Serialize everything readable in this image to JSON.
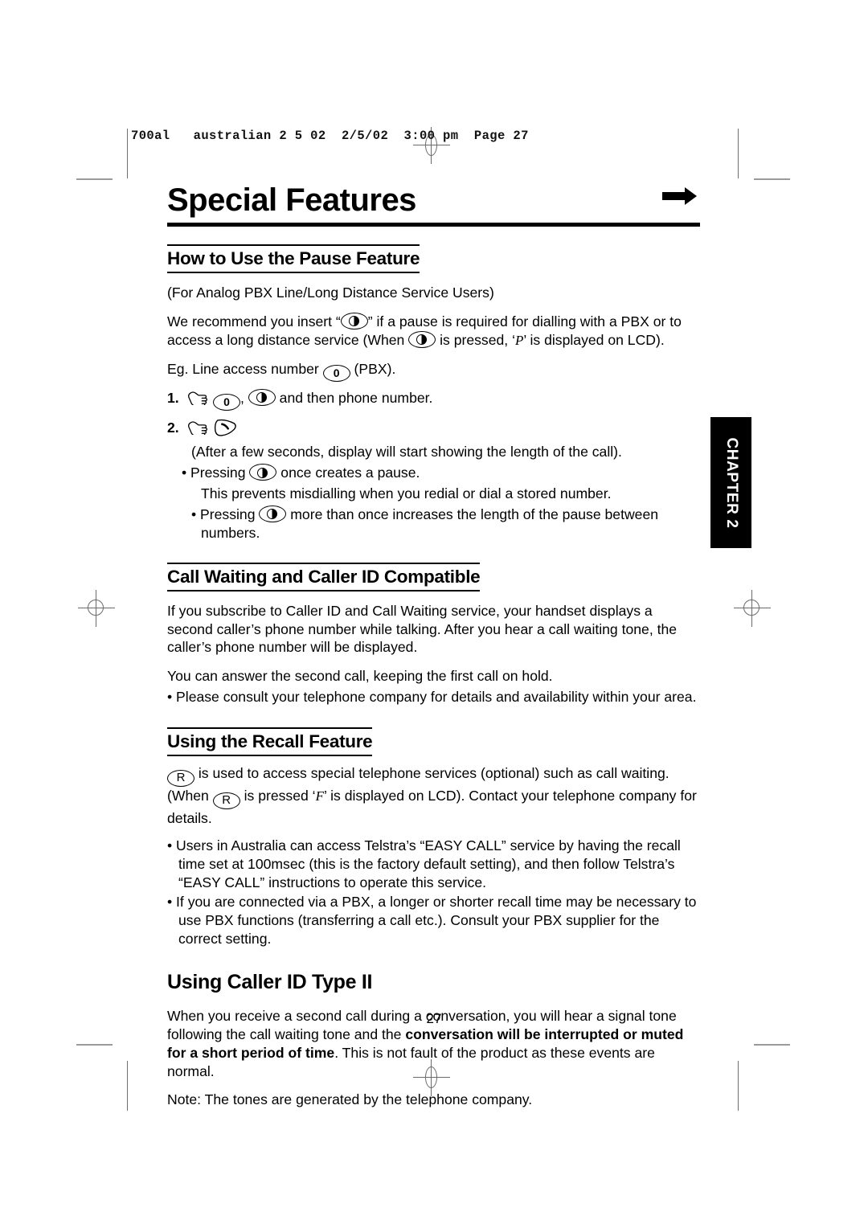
{
  "prepress": {
    "header_text": "700al   australian 2 5 02  2/5/02  3:00 pm  Page 27"
  },
  "chapter": {
    "title": "Special Features",
    "tab_label": "CHAPTER 2",
    "arrow_icon": "right-arrow-icon"
  },
  "page_number": "27",
  "sections": {
    "pause": {
      "heading": "How to Use the Pause Feature",
      "subtitle": "(For Analog PBX Line/Long Distance Service Users)",
      "intro_a": "We recommend you insert “",
      "intro_b": "” if a pause is required for dialling with a PBX or to access a long distance service (When ",
      "intro_c": " is pressed, ‘",
      "intro_lcd": "P",
      "intro_d": "’ is displayed on LCD).",
      "example_a": "Eg. Line access number ",
      "example_b": " (PBX).",
      "step1_num": "1.",
      "step1_sep": ", ",
      "step1_tail": " and then phone number.",
      "step2_num": "2.",
      "step2_note": "(After a few seconds, display will start showing the length of the call).",
      "bullet1_a": "• Pressing ",
      "bullet1_b": " once creates a pause.",
      "bullet1_sub": "This prevents misdialling when you redial or dial a stored number.",
      "bullet2_a": "• Pressing ",
      "bullet2_b": " more than once increases the length of the pause between numbers.",
      "key_zero_label": "0",
      "key_pause_icon": "pause-key-icon",
      "key_talk_icon": "talk-key-icon",
      "hand_icon": "pointing-hand-icon"
    },
    "call_waiting": {
      "heading": "Call Waiting and Caller ID Compatible",
      "para1": "If you subscribe to Caller ID and Call Waiting service, your handset displays a second caller’s phone number while talking. After you hear a call waiting tone, the caller’s phone number will be displayed.",
      "para2": "You can answer the second call, keeping the first call on hold.",
      "bullet1": "• Please consult your telephone company for details and availability within your area."
    },
    "recall": {
      "heading": "Using the Recall Feature",
      "key_r_label": "R",
      "intro_a": " is used to access special telephone services (optional) such as call waiting. (When ",
      "intro_b": " is pressed ‘",
      "intro_lcd": "F",
      "intro_c": "’ is displayed on LCD). Contact your telephone company for details.",
      "bullet1": "• Users in Australia can access Telstra’s “EASY CALL” service by having the recall time set at 100msec (this is the factory default setting), and then follow Telstra’s “EASY CALL” instructions to operate this service.",
      "bullet2": "• If you are connected via a PBX, a longer or shorter recall time may be necessary to use PBX functions (transferring a call etc.). Consult your PBX supplier for the correct setting."
    },
    "caller_id_type2": {
      "heading": "Using Caller ID Type II",
      "para1_a": "When you receive a second call during a conversation, you will hear a signal tone following the call waiting tone and the ",
      "para1_bold": "conversation will be interrupted or muted for a short period of time",
      "para1_b": ". This is not fault of the product as these events are normal.",
      "note": "Note: The tones are generated by the telephone company."
    }
  }
}
